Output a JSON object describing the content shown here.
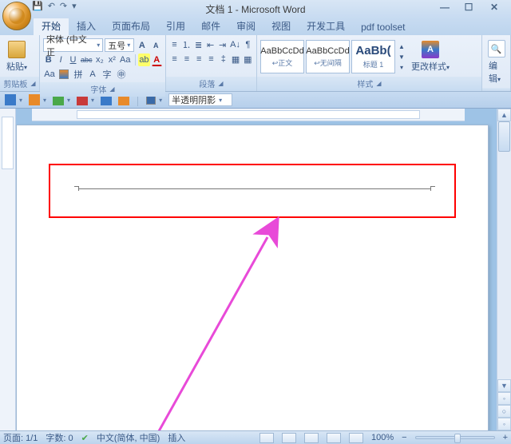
{
  "titlebar": {
    "title": "文档 1 - Microsoft Word",
    "min": "—",
    "max": "☐",
    "close": "✕",
    "qat_save": "💾",
    "qat_undo": "↶",
    "qat_redo": "↷",
    "qat_dd": "▾"
  },
  "tabs": {
    "home": "开始",
    "insert": "插入",
    "layout": "页面布局",
    "ref": "引用",
    "mail": "邮件",
    "review": "审阅",
    "view": "视图",
    "dev": "开发工具",
    "pdf": "pdf toolset"
  },
  "clipboard": {
    "paste": "粘贴",
    "label": "剪贴板",
    "dd": "▾"
  },
  "font": {
    "name": "宋体 (中文正",
    "size": "五号",
    "grow": "A",
    "shrink": "A",
    "clear": "Aa",
    "label": "字体",
    "bold": "B",
    "italic": "I",
    "underline": "U",
    "strike": "abc",
    "sub": "x₂",
    "sup": "x²",
    "case": "Aa",
    "highlight": "ab",
    "color": "A"
  },
  "para": {
    "label": "段落",
    "bul": "≡",
    "num": "⒈",
    "multi": "≣",
    "indentL": "⇤",
    "indentR": "⇥",
    "sort": "A↓",
    "marks": "¶",
    "al": "≡",
    "ac": "≡",
    "ar": "≡",
    "aj": "≡",
    "spacing": "‡",
    "shade": "▦",
    "border": "▦"
  },
  "styles": {
    "label": "样式",
    "s1": {
      "sample": "AaBbCcDd",
      "name": "↩正文"
    },
    "s2": {
      "sample": "AaBbCcDd",
      "name": "↩无间隔"
    },
    "s3": {
      "sample": "AaBb(",
      "name": "标题 1"
    },
    "change": "更改样式",
    "changeIcon": "A"
  },
  "editing_label": "编辑",
  "toolbar2": {
    "shadow": "半透明阴影",
    "swatch": "▾"
  },
  "status": {
    "page": "页面: 1/1",
    "words": "字数: 0",
    "lang": "中文(简体, 中国)",
    "insert": "插入",
    "zoom": "100%",
    "minus": "−",
    "plus": "+"
  },
  "scroll": {
    "up": "▲",
    "down": "▼",
    "prev": "◦",
    "next": "◦"
  }
}
